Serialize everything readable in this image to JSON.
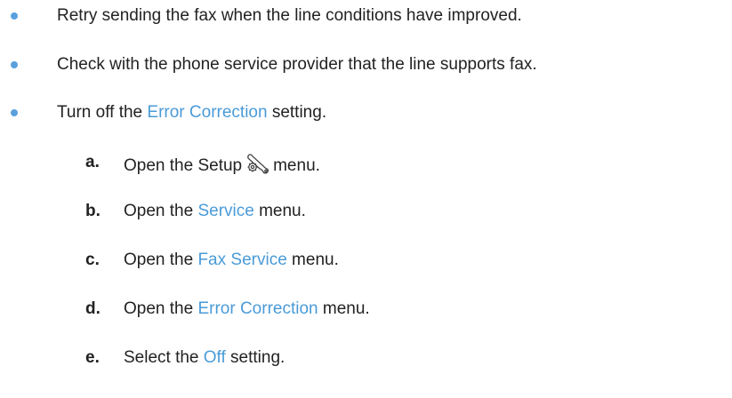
{
  "bullets": [
    {
      "text": "Retry sending the fax when the line conditions have improved."
    },
    {
      "text": "Check with the phone service provider that the line supports fax."
    },
    {
      "pre": "Turn off the ",
      "highlight": "Error Correction",
      "post": " setting."
    }
  ],
  "steps": [
    {
      "letter": "a.",
      "pre": "Open the Setup",
      "icon": "setup-wrench-gear-icon",
      "post": "menu."
    },
    {
      "letter": "b.",
      "pre": "Open the ",
      "highlight": "Service",
      "post": " menu."
    },
    {
      "letter": "c.",
      "pre": "Open the ",
      "highlight": "Fax Service",
      "post": " menu."
    },
    {
      "letter": "d.",
      "pre": "Open the ",
      "highlight": "Error Correction",
      "post": " menu."
    },
    {
      "letter": "e.",
      "pre": "Select the ",
      "highlight": "Off",
      "post": " setting."
    }
  ],
  "colors": {
    "bullet": "#5aa0dc",
    "highlight": "#4a9bd8",
    "text": "#222222"
  }
}
